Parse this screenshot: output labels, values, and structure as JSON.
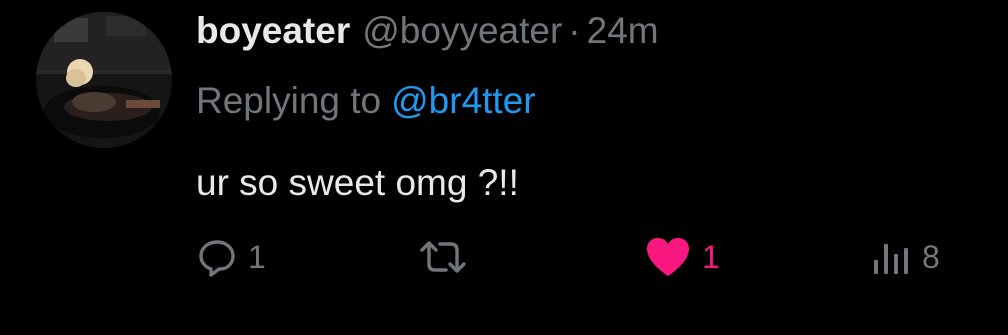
{
  "tweet": {
    "display_name": "boyeater",
    "handle": "@boyyeater",
    "separator": "·",
    "time": "24m",
    "reply_prefix": "Replying to",
    "reply_mention": "@br4tter",
    "text": "ur so sweet omg ?!!"
  },
  "actions": {
    "reply_count": "1",
    "retweet_count": "",
    "like_count": "1",
    "views_count": "8"
  },
  "icons": {
    "reply": "reply-bubble-icon",
    "retweet": "retweet-icon",
    "like": "heart-icon-filled",
    "views": "analytics-bars-icon"
  },
  "colors": {
    "background": "#000000",
    "text_primary": "#e7e9ea",
    "text_secondary": "#71767b",
    "mention": "#1d9bf0",
    "like_active": "#f91880"
  }
}
